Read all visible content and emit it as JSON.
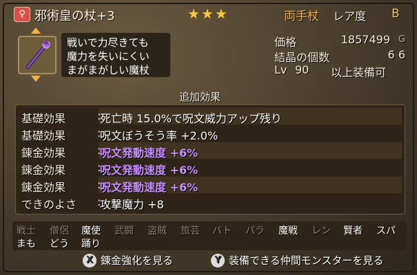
{
  "item": {
    "key_icon": "key-icon",
    "name": "邪術皇の杖+3",
    "stars": "★★★",
    "hand_type": "両手杖",
    "rarity_label": "レア度",
    "rarity_value": "B",
    "description": [
      "戦いで力尽きても",
      "魔力を失いにくい",
      "まがまがしい魔杖"
    ]
  },
  "stats": {
    "price_label": "価格",
    "price_value": "1857499",
    "price_unit": "G",
    "crystal_label": "結晶の個数",
    "crystal_value": "6 6",
    "lv_label": "Lv",
    "lv_value": "90",
    "lv_suffix": "以上装備可"
  },
  "extra_effects_header": "追加効果",
  "effects": [
    {
      "label": "基礎効果",
      "value": "死亡時 15.0%で呪文威力アップ残り",
      "color": "#ffffff"
    },
    {
      "label": "基礎効果",
      "value": "呪文ぼうそう率 +2.0%",
      "color": "#ffffff"
    },
    {
      "label": "錬金効果",
      "value": "呪文発動速度 +6%",
      "color": "#c98cff"
    },
    {
      "label": "錬金効果",
      "value": "呪文発動速度 +6%",
      "color": "#c98cff"
    },
    {
      "label": "錬金効果",
      "value": "呪文発動速度 +6%",
      "color": "#c98cff"
    },
    {
      "label": "できのよさ",
      "value": "攻撃魔力 +8",
      "color": "#ffffff"
    }
  ],
  "effect_colon": ":",
  "jobs_row1": [
    {
      "name": "戦士",
      "on": false
    },
    {
      "name": "僧侶",
      "on": false
    },
    {
      "name": "魔使",
      "on": true
    },
    {
      "name": "武闘",
      "on": false
    },
    {
      "name": "盗賊",
      "on": false
    },
    {
      "name": "旅芸",
      "on": false
    },
    {
      "name": "バト",
      "on": false
    },
    {
      "name": "パラ",
      "on": false
    },
    {
      "name": "魔戦",
      "on": true
    },
    {
      "name": "レン",
      "on": false
    },
    {
      "name": "賢者",
      "on": true
    },
    {
      "name": "スパ",
      "on": true
    }
  ],
  "jobs_row2": [
    {
      "name": "まも",
      "on": true
    },
    {
      "name": "どう",
      "on": true
    },
    {
      "name": "踊り",
      "on": true
    }
  ],
  "footer": {
    "x_button": "X",
    "x_label": "錬金強化を見る",
    "y_button": "Y",
    "y_label": "装備できる仲間モンスターを見る"
  },
  "colors": {
    "accent_gold": "#f2c94a",
    "alchemy_purple": "#c98cff"
  }
}
